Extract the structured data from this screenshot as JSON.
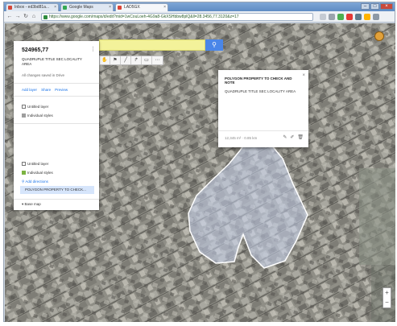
{
  "browser": {
    "tabs": [
      {
        "label": "Inbox - ed3bd81a...",
        "favicon_color": "#d44638"
      },
      {
        "label": "Google Maps",
        "favicon_color": "#34a853"
      },
      {
        "label": "LAD5GX",
        "favicon_color": "#db4437"
      }
    ],
    "url": "https://www.google.com/maps/d/edit?mid=1wCouLoeh-4G9a8-GkXSHbbw8plQ&ll=28.3456,77.3120&z=17"
  },
  "map": {
    "search": {
      "value": "",
      "placeholder": "",
      "button_icon": "search-icon"
    },
    "tools": [
      "hand",
      "marker",
      "line",
      "route",
      "ruler"
    ]
  },
  "panel": {
    "title": "524965,77",
    "description": "QUADRUPLE TITLE SEC LOCALITY AREA",
    "subtitle": "All changes saved in Drive",
    "actions": {
      "add_layer": "Add layer",
      "share": "Share",
      "preview": "Preview"
    },
    "layers": [
      {
        "name": "Untitled layer",
        "style": "Individual styles",
        "color": "#9e9e9e"
      },
      {
        "name": "Untitled layer",
        "style": "Individual styles",
        "color": "#7cb342"
      }
    ],
    "feature": {
      "link": "Add directions",
      "selected_item": "POLYGON PROPERTY TO CHECK..."
    },
    "base_map": "Base map"
  },
  "popup": {
    "title": "POLYGON PROPERTY TO CHECK AND NOTE",
    "description": "QUADRUPLE TITLE SEC LOCALITY AREA",
    "footer": "12,345 m² · 0.85 km"
  },
  "colors": {
    "search_fill": "#f3f29a",
    "search_button": "#4a86e8",
    "polygon": "#c9d3ef"
  }
}
